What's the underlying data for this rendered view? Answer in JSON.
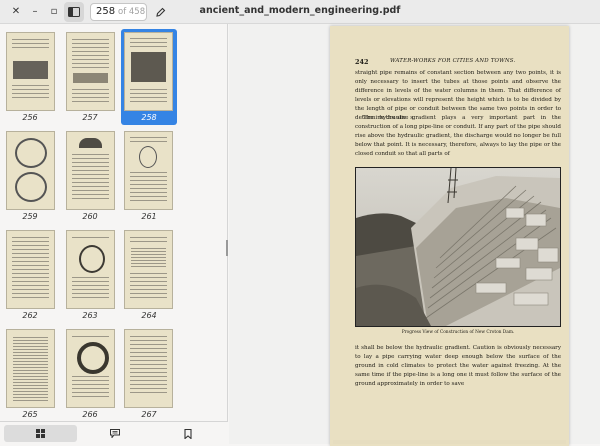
{
  "window": {
    "title": "ancient_and_modern_engineering.pdf",
    "close_glyph": "✕",
    "minimize_glyph": "–",
    "maximize_glyph": "▫"
  },
  "toolbar": {
    "current_page": "258",
    "total_pages": "of 458"
  },
  "thumbnails": [
    {
      "label": "256"
    },
    {
      "label": "257"
    },
    {
      "label": "258"
    },
    {
      "label": "259"
    },
    {
      "label": "260"
    },
    {
      "label": "261"
    },
    {
      "label": "262"
    },
    {
      "label": "263"
    },
    {
      "label": "264"
    },
    {
      "label": "265"
    },
    {
      "label": "266"
    },
    {
      "label": "267"
    }
  ],
  "selected_thumbnail": "258",
  "page": {
    "number": "242",
    "running_head": "WATER-WORKS FOR CITIES AND TOWNS.",
    "para1": "straight pipe remains of constant section between any two points, it is only necessary to insert the tubes at those points and observe the difference in levels of the water columns in them.  That difference of levels or elevations will represent the height which is to be divided by the length of pipe or conduit between the same two points in order to determine the sine s.",
    "para2": "The hydraulic gradient plays a very important part in the construction of a long pipe-line or conduit.  If any part of the pipe should rise above the hydraulic gradient, the discharge would no longer be full below that point.  It is necessary, therefore, always to lay the pipe or the closed conduit so that all parts of",
    "caption": "Progress View of Construction of New Croton Dam.",
    "para3": "it shall be below the hydraulic gradient.  Caution is obviously necessary to lay a pipe carrying water deep enough below the surface of the ground in cold climates to protect the water against freezing.  At the same time if the pipe-line is a long one it must follow the surface of the ground approximately in order to save"
  },
  "colors": {
    "selection": "#3584e4",
    "paper": "#e9e0c2"
  }
}
